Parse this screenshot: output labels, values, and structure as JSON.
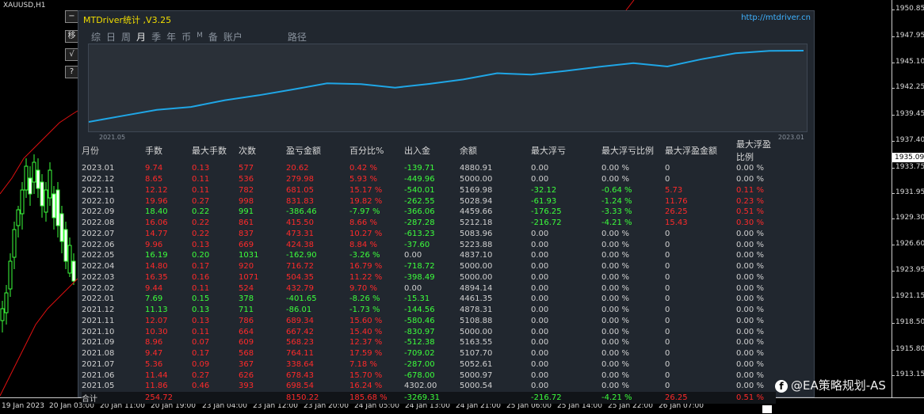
{
  "chart": {
    "symbol": "XAUUSD,H1",
    "price_labels": [
      "1950.85",
      "1947.95",
      "1945.10",
      "1942.25",
      "1939.45",
      "1937.40",
      "1935.09",
      "1933.75",
      "1931.95",
      "1929.30",
      "1926.60",
      "1923.95",
      "1921.15",
      "1918.50",
      "1915.80",
      "1913.15"
    ],
    "current_price": "1935.09",
    "time_labels": [
      "19 Jan 2023",
      "20 Jan 03:00",
      "20 Jan 11:00",
      "20 Jan 19:00",
      "23 Jan 04:00",
      "23 Jan 12:00",
      "23 Jan 20:00",
      "24 Jan 05:00",
      "24 Jan 13:00",
      "24 Jan 21:00",
      "25 Jan 06:00",
      "25 Jan 14:00",
      "25 Jan 22:00",
      "26 Jan 07:00"
    ]
  },
  "side_buttons": [
    "−",
    "移",
    "√",
    "?"
  ],
  "panel": {
    "title": "MTDriver统计 ,V3.25",
    "url": "http://mtdriver.cn",
    "tabs": [
      "综",
      "日",
      "周",
      "月",
      "季",
      "年",
      "币",
      "M",
      "备",
      "账户",
      "路径"
    ],
    "active_tab": "月",
    "equity_start": "2021.05",
    "equity_end": "2023.01",
    "headers": [
      "月份",
      "手数",
      "最大手数",
      "次数",
      "盈亏金额",
      "百分比%",
      "出入金",
      "余额",
      "最大浮亏",
      "最大浮亏比例",
      "最大浮盈金额",
      "最大浮盈比例"
    ],
    "rows": [
      [
        "2023.01",
        "9.74",
        "0.13",
        "577",
        "20.62",
        "0.42 %",
        "-139.71",
        "4880.91",
        "0.00",
        "0.00 %",
        "0",
        "0.00 %"
      ],
      [
        "2022.12",
        "8.65",
        "0.11",
        "536",
        "279.98",
        "5.93 %",
        "-449.96",
        "5000.00",
        "0.00",
        "0.00 %",
        "0",
        "0.00 %"
      ],
      [
        "2022.11",
        "12.12",
        "0.11",
        "782",
        "681.05",
        "15.17 %",
        "-540.01",
        "5169.98",
        "-32.12",
        "-0.64 %",
        "5.73",
        "0.11 %"
      ],
      [
        "2022.10",
        "19.96",
        "0.27",
        "998",
        "831.83",
        "19.82 %",
        "-262.55",
        "5028.94",
        "-61.93",
        "-1.24 %",
        "11.76",
        "0.23 %"
      ],
      [
        "2022.09",
        "18.40",
        "0.22",
        "991",
        "-386.46",
        "-7.97 %",
        "-366.06",
        "4459.66",
        "-176.25",
        "-3.33 %",
        "26.25",
        "0.51 %"
      ],
      [
        "2022.08",
        "16.06",
        "0.22",
        "861",
        "415.50",
        "8.66 %",
        "-287.28",
        "5212.18",
        "-216.72",
        "-4.21 %",
        "15.43",
        "0.30 %"
      ],
      [
        "2022.07",
        "14.77",
        "0.22",
        "837",
        "473.31",
        "10.27 %",
        "-613.23",
        "5083.96",
        "0.00",
        "0.00 %",
        "0",
        "0.00 %"
      ],
      [
        "2022.06",
        "9.96",
        "0.13",
        "669",
        "424.38",
        "8.84 %",
        "-37.60",
        "5223.88",
        "0.00",
        "0.00 %",
        "0",
        "0.00 %"
      ],
      [
        "2022.05",
        "16.19",
        "0.20",
        "1031",
        "-162.90",
        "-3.26 %",
        "0.00",
        "4837.10",
        "0.00",
        "0.00 %",
        "0",
        "0.00 %"
      ],
      [
        "2022.04",
        "14.80",
        "0.17",
        "920",
        "716.72",
        "16.79 %",
        "-718.72",
        "5000.00",
        "0.00",
        "0.00 %",
        "0",
        "0.00 %"
      ],
      [
        "2022.03",
        "16.35",
        "0.16",
        "1071",
        "504.35",
        "11.22 %",
        "-398.49",
        "5000.00",
        "0.00",
        "0.00 %",
        "0",
        "0.00 %"
      ],
      [
        "2022.02",
        "9.44",
        "0.11",
        "524",
        "432.79",
        "9.70 %",
        "0.00",
        "4894.14",
        "0.00",
        "0.00 %",
        "0",
        "0.00 %"
      ],
      [
        "2022.01",
        "7.69",
        "0.15",
        "378",
        "-401.65",
        "-8.26 %",
        "-15.31",
        "4461.35",
        "0.00",
        "0.00 %",
        "0",
        "0.00 %"
      ],
      [
        "2021.12",
        "11.13",
        "0.13",
        "711",
        "-86.01",
        "-1.73 %",
        "-144.56",
        "4878.31",
        "0.00",
        "0.00 %",
        "0",
        "0.00 %"
      ],
      [
        "2021.11",
        "12.07",
        "0.13",
        "786",
        "689.34",
        "15.60 %",
        "-580.46",
        "5108.88",
        "0.00",
        "0.00 %",
        "0",
        "0.00 %"
      ],
      [
        "2021.10",
        "10.30",
        "0.11",
        "664",
        "667.42",
        "15.40 %",
        "-830.97",
        "5000.00",
        "0.00",
        "0.00 %",
        "0",
        "0.00 %"
      ],
      [
        "2021.09",
        "8.96",
        "0.07",
        "609",
        "568.23",
        "12.37 %",
        "-512.38",
        "5163.55",
        "0.00",
        "0.00 %",
        "0",
        "0.00 %"
      ],
      [
        "2021.08",
        "9.47",
        "0.17",
        "568",
        "764.11",
        "17.59 %",
        "-709.02",
        "5107.70",
        "0.00",
        "0.00 %",
        "0",
        "0.00 %"
      ],
      [
        "2021.07",
        "5.36",
        "0.09",
        "367",
        "338.64",
        "7.18 %",
        "-287.00",
        "5052.61",
        "0.00",
        "0.00 %",
        "0",
        "0.00 %"
      ],
      [
        "2021.06",
        "11.44",
        "0.27",
        "626",
        "678.43",
        "15.70 %",
        "-678.00",
        "5000.97",
        "0.00",
        "0.00 %",
        "0",
        "0.00 %"
      ],
      [
        "2021.05",
        "11.86",
        "0.46",
        "393",
        "698.54",
        "16.24 %",
        "4302.00",
        "5000.54",
        "0.00",
        "0.00 %",
        "0",
        "0.00 %"
      ]
    ],
    "total": [
      "合计",
      "254.72",
      "",
      "",
      "8150.22",
      "185.68 %",
      "-3269.31",
      "",
      "-216.72",
      "-4.21 %",
      "26.25",
      "0.51 %"
    ]
  },
  "watermark": "@EA策略规划-AS",
  "colors": {
    "profit": "#ff2a2a",
    "loss": "#3cff3c",
    "title": "#f2de00",
    "equity_line": "#1fa6e6"
  }
}
